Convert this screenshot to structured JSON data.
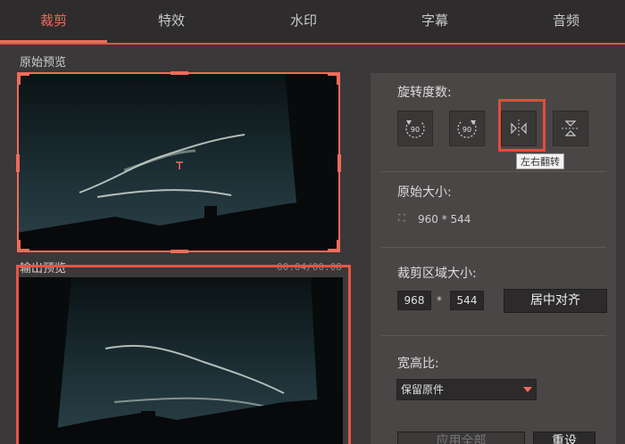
{
  "tabs": [
    {
      "label": "裁剪",
      "active": true
    },
    {
      "label": "特效",
      "active": false
    },
    {
      "label": "水印",
      "active": false
    },
    {
      "label": "字幕",
      "active": false
    },
    {
      "label": "音频",
      "active": false
    }
  ],
  "original_preview": {
    "label": "原始预览"
  },
  "output_preview": {
    "label": "输出预览",
    "timecode": "00:04/00:08"
  },
  "rotation": {
    "label": "旋转度数:",
    "buttons": [
      {
        "name": "rotate-left-90",
        "text": "90"
      },
      {
        "name": "rotate-right-90",
        "text": "90"
      },
      {
        "name": "flip-horizontal",
        "text": ""
      },
      {
        "name": "flip-vertical",
        "text": ""
      }
    ],
    "tooltip": "左右翻转"
  },
  "original_size": {
    "label": "原始大小:",
    "value": "960 * 544"
  },
  "crop_size": {
    "label": "裁剪区域大小:",
    "width": "968",
    "times": "*",
    "height": "544",
    "center_button": "居中对齐"
  },
  "aspect_ratio": {
    "label": "宽高比:",
    "selected": "保留原件"
  },
  "actions": {
    "apply_all": "应用全部",
    "reset": "重设"
  },
  "colors": {
    "accent": "#f06b5a",
    "highlight": "#e84a3c",
    "panel": "#4a4646",
    "background": "#3a3838"
  }
}
